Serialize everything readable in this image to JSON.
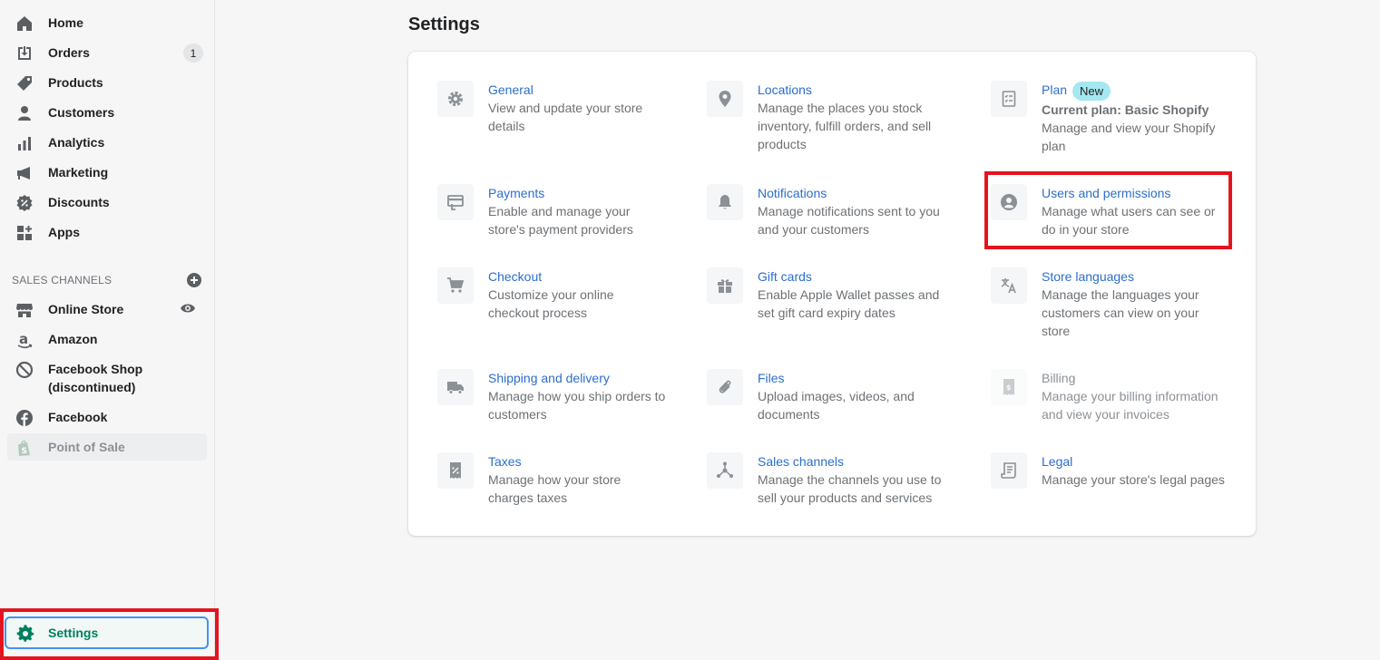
{
  "sidebar": {
    "items": [
      {
        "label": "Home"
      },
      {
        "label": "Orders",
        "badge": "1"
      },
      {
        "label": "Products"
      },
      {
        "label": "Customers"
      },
      {
        "label": "Analytics"
      },
      {
        "label": "Marketing"
      },
      {
        "label": "Discounts"
      },
      {
        "label": "Apps"
      }
    ],
    "sales_channels_heading": "SALES CHANNELS",
    "channels": [
      {
        "label": "Online Store"
      },
      {
        "label": "Amazon"
      },
      {
        "label": "Facebook Shop (discontinued)"
      },
      {
        "label": "Facebook"
      },
      {
        "label": "Point of Sale"
      }
    ],
    "settings_label": "Settings"
  },
  "main": {
    "title": "Settings",
    "tiles": [
      {
        "title": "General",
        "desc": "View and update your store details"
      },
      {
        "title": "Locations",
        "desc": "Manage the places you stock inventory, fulfill orders, and sell products"
      },
      {
        "title": "Plan",
        "badge": "New",
        "current": "Current plan: Basic Shopify",
        "desc": "Manage and view your Shopify plan"
      },
      {
        "title": "Payments",
        "desc": "Enable and manage your store's payment providers"
      },
      {
        "title": "Notifications",
        "desc": "Manage notifications sent to you and your customers"
      },
      {
        "title": "Users and permissions",
        "desc": "Manage what users can see or do in your store"
      },
      {
        "title": "Checkout",
        "desc": "Customize your online checkout process"
      },
      {
        "title": "Gift cards",
        "desc": "Enable Apple Wallet passes and set gift card expiry dates"
      },
      {
        "title": "Store languages",
        "desc": "Manage the languages your customers can view on your store"
      },
      {
        "title": "Shipping and delivery",
        "desc": "Manage how you ship orders to customers"
      },
      {
        "title": "Files",
        "desc": "Upload images, videos, and documents"
      },
      {
        "title": "Billing",
        "desc": "Manage your billing information and view your invoices"
      },
      {
        "title": "Taxes",
        "desc": "Manage how your store charges taxes"
      },
      {
        "title": "Sales channels",
        "desc": "Manage the channels you use to sell your products and services"
      },
      {
        "title": "Legal",
        "desc": "Manage your store's legal pages"
      }
    ]
  },
  "colors": {
    "accent": "#2c6ecb",
    "highlight": "#e4141e",
    "active": "#007f5f"
  }
}
